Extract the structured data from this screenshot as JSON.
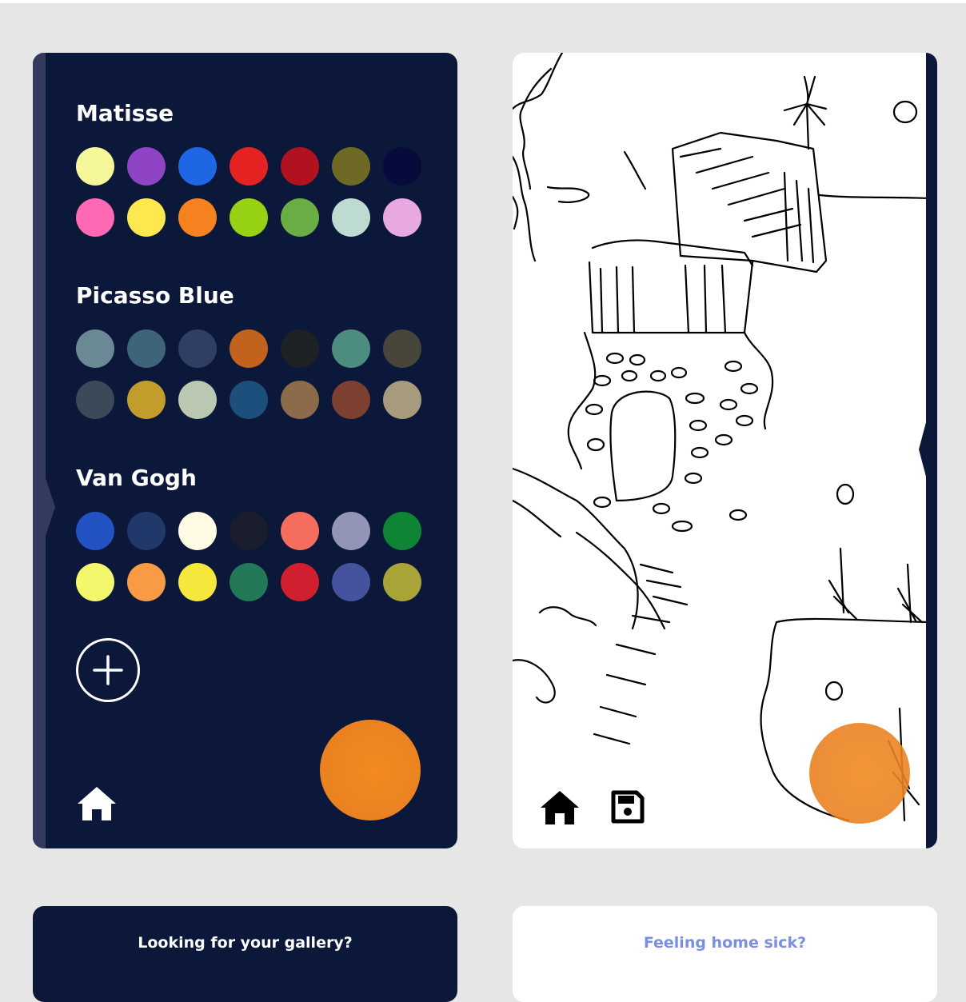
{
  "palettes": [
    {
      "name": "Matisse",
      "colors": [
        "#f5f79a",
        "#8e44c4",
        "#1f66e5",
        "#e52222",
        "#b0121f",
        "#6e6a25",
        "#060b3c",
        "#ff69b4",
        "#fde94f",
        "#f5821f",
        "#97d114",
        "#6aad45",
        "#bddbd0",
        "#e8a8e2"
      ]
    },
    {
      "name": "Picasso Blue",
      "colors": [
        "#6a8995",
        "#3d6479",
        "#2e3f63",
        "#c1621e",
        "#1e2124",
        "#4c8d80",
        "#48453a",
        "#3a4a58",
        "#c39d2c",
        "#bac8b2",
        "#1c4f7b",
        "#8b6b4a",
        "#7d4030",
        "#a89a7c"
      ]
    },
    {
      "name": "Van Gogh",
      "colors": [
        "#2352c2",
        "#20386a",
        "#fffbe4",
        "#1a1e2c",
        "#f46d5e",
        "#9295b5",
        "#0d8534",
        "#f3f76b",
        "#f99b45",
        "#f5e73c",
        "#237858",
        "#d01f2e",
        "#45539e",
        "#a8a438"
      ]
    }
  ],
  "icons": {
    "add": "plus-circle-icon",
    "home": "home-icon",
    "save": "floppy-disk-icon"
  },
  "current_color": "#f28a20",
  "cards": {
    "gallery_prompt": "Looking for your gallery?",
    "home_prompt": "Feeling home sick?"
  }
}
